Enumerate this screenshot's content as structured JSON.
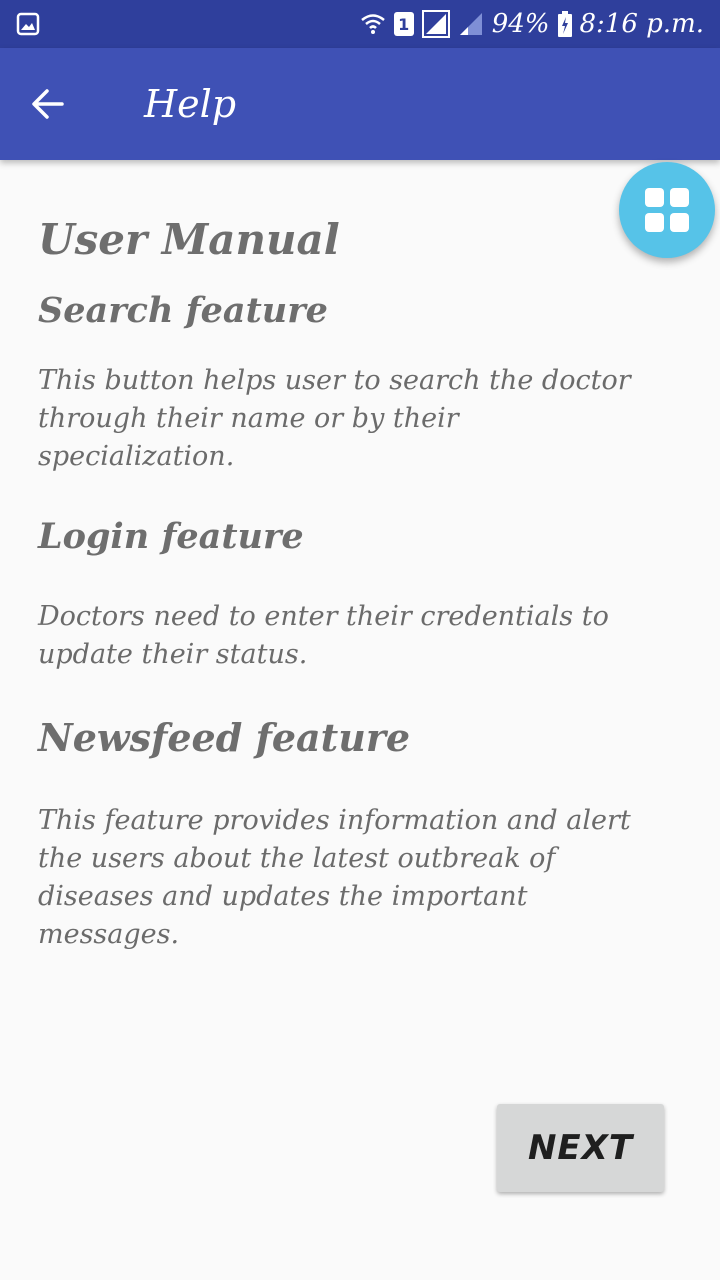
{
  "status_bar": {
    "battery_percent": "94%",
    "time": "8:16 p.m.",
    "sim_number": "1",
    "icons": [
      "gallery-notification-icon",
      "wifi-icon",
      "sim-icon",
      "signal-icon",
      "signal-icon",
      "battery-charging-icon"
    ]
  },
  "app_bar": {
    "title": "Help",
    "back_icon": "arrow-back-icon"
  },
  "fab": {
    "icon": "grid-icon",
    "color": "#56c3e8"
  },
  "content": {
    "title": "User Manual",
    "sections": [
      {
        "heading": "Search feature",
        "body": "This button helps user to search the doctor through their name or by their specialization."
      },
      {
        "heading": "Login feature",
        "body": "Doctors need to enter their credentials to update their status."
      },
      {
        "heading": "Newsfeed feature",
        "body": "This feature provides information and alert the users about the latest outbreak of diseases and updates the important messages."
      }
    ]
  },
  "actions": {
    "next_label": "NEXT"
  },
  "colors": {
    "status_bar": "#2f3f9c",
    "app_bar": "#3f51b5",
    "background": "#fafafa",
    "button": "#d6d7d7",
    "text": "#6b6b6b"
  }
}
